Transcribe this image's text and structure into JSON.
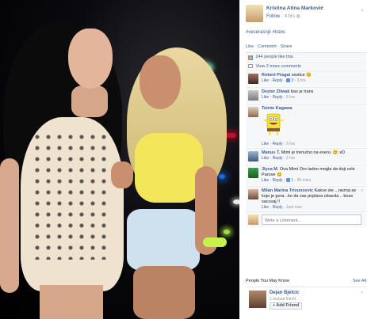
{
  "post": {
    "author": "Kristina Atina Marković",
    "follow": "Follow",
    "time": "4 hrs",
    "tags": "#vecerasnjii #trans",
    "actions": {
      "like": "Like",
      "comment": "Comment",
      "share": "Share"
    },
    "likes_text": "244 people like this.",
    "view_more": "View 2 more comments"
  },
  "comments": [
    {
      "name": "Robert Pragai",
      "text": "vestice",
      "emoji": "😊",
      "like": "Like",
      "reply": "Reply",
      "likes": "3",
      "time": "3 hrs"
    },
    {
      "name": "Dexter Zliwak",
      "text": "bas je trans",
      "like": "Like",
      "reply": "Reply",
      "time": "3 hrs"
    },
    {
      "name": "Tuinte Kagawa",
      "text": "",
      "like": "Like",
      "reply": "Reply",
      "time": "3 hrs"
    },
    {
      "name": "Manus T.",
      "text": "Mimi je trenutno na everu.",
      "emoji": "😊",
      "extra": "xD",
      "like": "Like",
      "reply": "Reply",
      "time": "2 hrs"
    },
    {
      "name": "Jlyca M.",
      "text": "Ova Mimi Oro ladno mogla da doji cele Parove",
      "emoji": "😊",
      "like": "Like",
      "reply": "Reply",
      "likes": "1",
      "time": "39 mins"
    },
    {
      "name": "Milan Marina Trivunceviс",
      "text": "Kakve ste ...nezna se koja je gora ..ko da vas poplava izbacila .. boze sacuvaj !!",
      "like": "Like",
      "reply": "Reply",
      "time": "Just now"
    }
  ],
  "write_placeholder": "Write a comment...",
  "pymk": {
    "title": "People You May Know",
    "see_all": "See All",
    "person": {
      "name": "Dejan Bjelcic",
      "mutual": "1 mutual friend",
      "add": "Add Friend"
    }
  },
  "colors": {
    "link": "#3b5998",
    "meta": "#90949c",
    "like_icon": "#5890ff"
  }
}
